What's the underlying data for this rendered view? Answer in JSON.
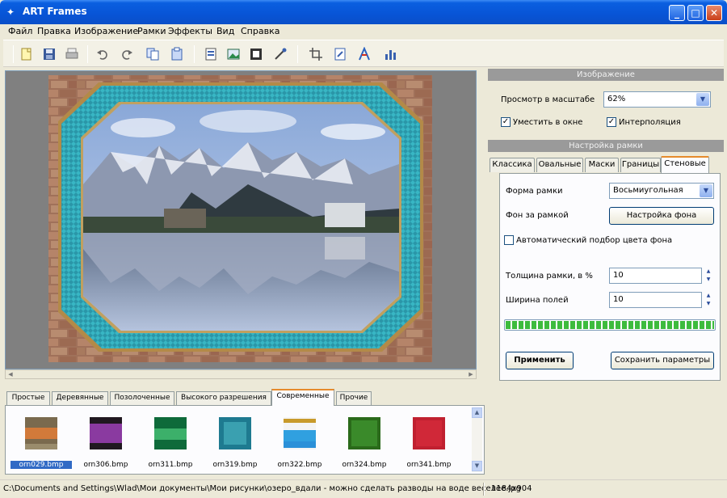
{
  "window": {
    "title": "ART Frames"
  },
  "menu": [
    "Файл",
    "Правка",
    "Изображение",
    "Рамки",
    "Эффекты",
    "Вид",
    "Справка"
  ],
  "toolbar": {
    "buttons": [
      "new-icon",
      "save-icon",
      "print-icon",
      "undo-icon",
      "redo-icon",
      "copy-icon",
      "paste-icon",
      "image-props-icon",
      "picture-icon",
      "frame-icon",
      "effects-icon",
      "crop-icon",
      "edit-icon",
      "text-icon",
      "chart-icon"
    ]
  },
  "image_panel": {
    "header": "Изображение",
    "zoom_label": "Просмотр в масштабе",
    "zoom_value": "62%",
    "fit_checkbox": {
      "label": "Уместить в окне",
      "checked": true
    },
    "interp_checkbox": {
      "label": "Интерполяция",
      "checked": true
    }
  },
  "frame_panel": {
    "header": "Настройка рамки",
    "tabs": [
      "Классика",
      "Овальные",
      "Маски",
      "Границы",
      "Стеновые"
    ],
    "active_tab": "Стеновые",
    "shape_label": "Форма рамки",
    "shape_value": "Восьмиугольная",
    "bg_label": "Фон за рамкой",
    "bg_button": "Настройка фона",
    "auto_color": {
      "label": "Автоматический подбор цвета фона",
      "checked": false
    },
    "thickness_label": "Толщина рамки, в %",
    "thickness_value": "10",
    "margin_label": "Ширина полей",
    "margin_value": "10",
    "progress": 1.0,
    "apply_button": "Применить",
    "save_button": "Сохранить параметры"
  },
  "gallery": {
    "tabs": [
      "Простые",
      "Деревянные",
      "Позолоченные",
      "Высокого разрешения",
      "Современные",
      "Прочие"
    ],
    "active_tab": "Современные",
    "items": [
      {
        "name": "orn029.bmp",
        "colors": [
          "#7a6a4e",
          "#d27a3a",
          "#9a8c6c"
        ]
      },
      {
        "name": "orn306.bmp",
        "colors": [
          "#201820",
          "#8a3aa0",
          "#201820"
        ]
      },
      {
        "name": "orn311.bmp",
        "colors": [
          "#0e6a3a",
          "#3cb06a",
          "#0e6a3a"
        ]
      },
      {
        "name": "orn319.bmp",
        "colors": [
          "#1e7a90",
          "#3aa0b0",
          "#1e7a90"
        ]
      },
      {
        "name": "orn322.bmp",
        "colors": [
          "#c89a2a",
          "#30a0e0",
          "#2a90d8"
        ]
      },
      {
        "name": "orn324.bmp",
        "colors": [
          "#2a6a1a",
          "#3a8a2a",
          "#2a6a1a"
        ]
      },
      {
        "name": "orn341.bmp",
        "colors": [
          "#c02030",
          "#d02838",
          "#c02030"
        ]
      }
    ]
  },
  "status": {
    "path": "C:\\Documents and Settings\\Wlad\\Мои документы\\Мои рисунки\\озеро_вдали - можно сделать разводы на воде веселее.jpg",
    "size": "1184x904"
  }
}
